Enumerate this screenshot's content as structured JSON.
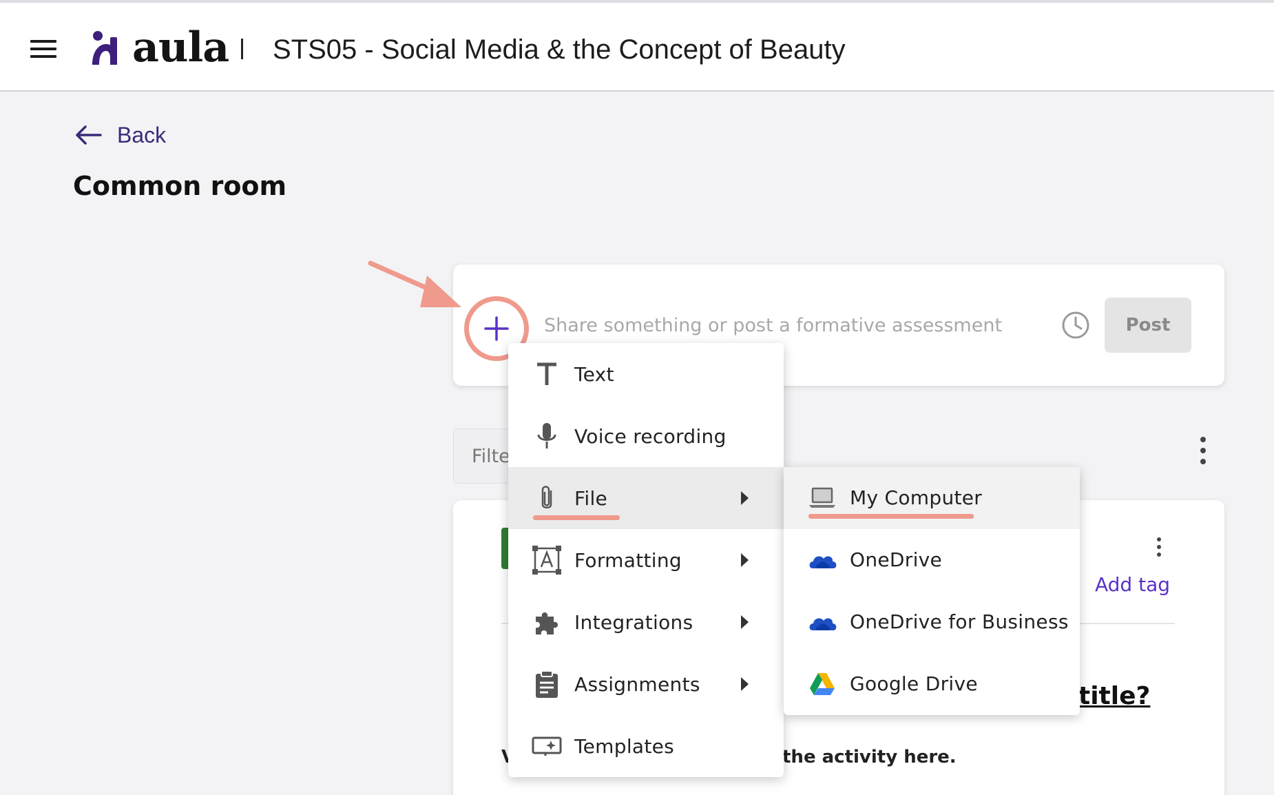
{
  "header": {
    "brand": "aula",
    "separator": "|",
    "course_title": "STS05 - Social Media & the Concept of Beauty"
  },
  "nav": {
    "back_label": "Back"
  },
  "page": {
    "title": "Common room"
  },
  "composer": {
    "placeholder": "Share something or post a formative assessment",
    "post_label": "Post"
  },
  "filter": {
    "label": "Filter"
  },
  "menu": {
    "items": [
      {
        "label": "Text",
        "icon": "text-icon"
      },
      {
        "label": "Voice recording",
        "icon": "microphone-icon"
      },
      {
        "label": "File",
        "icon": "paperclip-icon",
        "has_submenu": true,
        "active": true
      },
      {
        "label": "Formatting",
        "icon": "formatting-icon",
        "has_submenu": true
      },
      {
        "label": "Integrations",
        "icon": "puzzle-icon",
        "has_submenu": true
      },
      {
        "label": "Assignments",
        "icon": "clipboard-icon",
        "has_submenu": true
      },
      {
        "label": "Templates",
        "icon": "template-icon"
      }
    ]
  },
  "file_submenu": {
    "items": [
      {
        "label": "My Computer",
        "icon": "laptop-icon",
        "active": true
      },
      {
        "label": "OneDrive",
        "icon": "onedrive-icon"
      },
      {
        "label": "OneDrive for Business",
        "icon": "onedrive-business-icon"
      },
      {
        "label": "Google Drive",
        "icon": "google-drive-icon"
      }
    ]
  },
  "card": {
    "add_tag_label": "Add tag",
    "title_fragment": "title?",
    "body_fragment": "the activity here.",
    "body_start": "V"
  },
  "colors": {
    "accent": "#5a32c8",
    "annotation": "#ef9a8c",
    "post_disabled_bg": "#e4e4e4",
    "menu_active_bg": "#ebebeb"
  }
}
